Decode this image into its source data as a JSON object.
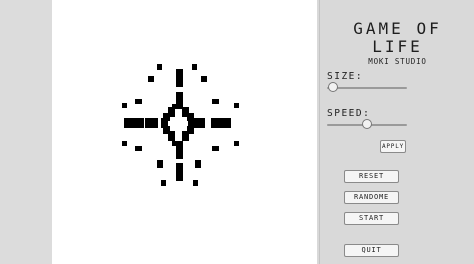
{
  "window": {
    "title": "GAME OF LIFE"
  },
  "panel": {
    "title_line1": "GAME OF",
    "title_line2": "LIFE",
    "subtitle": "MOKI STUDIO",
    "size_label": "SIZE:",
    "size_value": 0.08,
    "speed_label": "SPEED:",
    "speed_value": 0.5,
    "apply_label": "APPLY",
    "reset_label": "RESET",
    "random_label": "RANDOME",
    "start_label": "START",
    "quit_label": "QUIT"
  },
  "board": {
    "cell_color": "#000000",
    "background": "#ffffff",
    "cells": [
      [
        129,
        0
      ],
      [
        130,
        0
      ],
      [
        131,
        0
      ],
      [
        131,
        1
      ],
      [
        132,
        1
      ],
      [
        132,
        2
      ],
      [
        133,
        2
      ]
    ]
  }
}
